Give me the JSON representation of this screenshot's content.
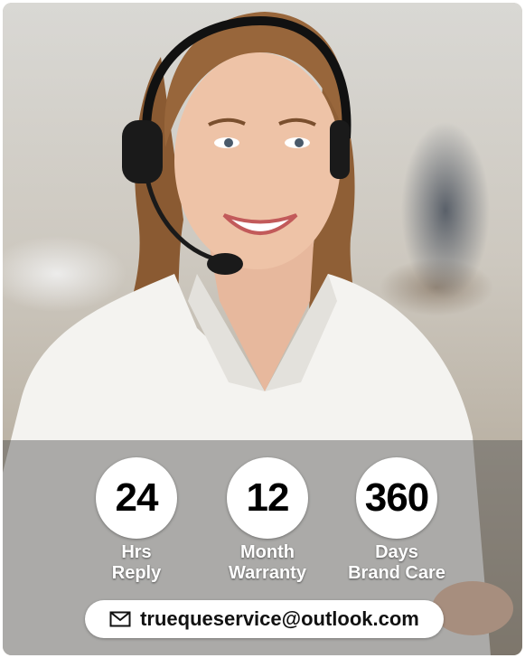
{
  "stats": [
    {
      "number": "24",
      "line1": "Hrs",
      "line2": "Reply"
    },
    {
      "number": "12",
      "line1": "Month",
      "line2": "Warranty"
    },
    {
      "number": "360",
      "line1": "Days",
      "line2": "Brand Care"
    }
  ],
  "contact": {
    "email": "truequeservice@outlook.com",
    "icon": "envelope-icon"
  },
  "colors": {
    "overlay": "#464646",
    "badge": "#ffffff",
    "text": "#000000"
  }
}
